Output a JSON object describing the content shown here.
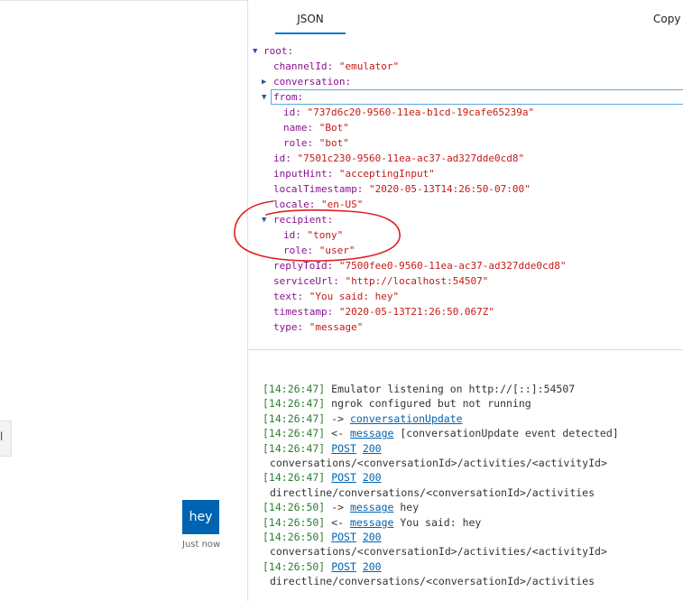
{
  "inspector": {
    "tab_json": "JSON",
    "copy_label": "Copy j"
  },
  "json": {
    "root": "root:",
    "channelId_key": "channelId:",
    "channelId_val": "\"emulator\"",
    "conversation_key": "conversation:",
    "from_key": "from:",
    "from_id_key": "id:",
    "from_id_val": "\"737d6c20-9560-11ea-b1cd-19cafe65239a\"",
    "from_name_key": "name:",
    "from_name_val": "\"Bot\"",
    "from_role_key": "role:",
    "from_role_val": "\"bot\"",
    "id_key": "id:",
    "id_val": "\"7501c230-9560-11ea-ac37-ad327dde0cd8\"",
    "inputHint_key": "inputHint:",
    "inputHint_val": "\"acceptingInput\"",
    "localTimestamp_key": "localTimestamp:",
    "localTimestamp_val": "\"2020-05-13T14:26:50-07:00\"",
    "locale_key": "locale:",
    "locale_val": "\"en-US\"",
    "recipient_key": "recipient:",
    "recipient_id_key": "id:",
    "recipient_id_val": "\"tony\"",
    "recipient_role_key": "role:",
    "recipient_role_val": "\"user\"",
    "replyToId_key": "replyToId:",
    "replyToId_val": "\"7500fee0-9560-11ea-ac37-ad327dde0cd8\"",
    "serviceUrl_key": "serviceUrl:",
    "serviceUrl_val": "\"http://localhost:54507\"",
    "text_key": "text:",
    "text_val": "\"You said: hey\"",
    "timestamp_key": "timestamp:",
    "timestamp_val": "\"2020-05-13T21:26:50.067Z\"",
    "type_key": "type:",
    "type_val": "\"message\""
  },
  "log": [
    {
      "ts": "[14:26:47]",
      "pre": " Emulator listening on http://[::]:54507",
      "link": "",
      "link2": "",
      "post": ""
    },
    {
      "ts": "[14:26:47]",
      "pre": " ngrok configured but not running",
      "link": "",
      "link2": "",
      "post": ""
    },
    {
      "ts": "[14:26:47]",
      "pre": " -> ",
      "link": "conversationUpdate",
      "link2": "",
      "post": ""
    },
    {
      "ts": "[14:26:47]",
      "pre": " <- ",
      "link": "message",
      "link2": "",
      "post": " [conversationUpdate event detected]"
    },
    {
      "ts": "[14:26:47]",
      "pre": " ",
      "link": "POST",
      "link2": "200",
      "post": ""
    },
    {
      "ts": "",
      "pre": "conversations/<conversationId>/activities/<activityId>",
      "link": "",
      "link2": "",
      "post": "",
      "indent": true
    },
    {
      "ts": "[14:26:47]",
      "pre": " ",
      "link": "POST",
      "link2": "200",
      "post": ""
    },
    {
      "ts": "",
      "pre": "directline/conversations/<conversationId>/activities",
      "link": "",
      "link2": "",
      "post": "",
      "indent": true
    },
    {
      "ts": "[14:26:50]",
      "pre": " -> ",
      "link": "message",
      "link2": "",
      "post": " hey"
    },
    {
      "ts": "[14:26:50]",
      "pre": " <- ",
      "link": "message",
      "link2": "",
      "post": " You said: hey"
    },
    {
      "ts": "[14:26:50]",
      "pre": " ",
      "link": "POST",
      "link2": "200",
      "post": ""
    },
    {
      "ts": "",
      "pre": "conversations/<conversationId>/activities/<activityId>",
      "link": "",
      "link2": "",
      "post": "",
      "indent": true
    },
    {
      "ts": "[14:26:50]",
      "pre": " ",
      "link": "POST",
      "link2": "200",
      "post": ""
    },
    {
      "ts": "",
      "pre": "directline/conversations/<conversationId>/activities",
      "link": "",
      "link2": "",
      "post": "",
      "indent": true
    }
  ],
  "chat": {
    "stub_char": "l",
    "bubble_text": "hey",
    "time_text": "Just now"
  },
  "colors": {
    "accent": "#0078d4",
    "bubble": "#0063b1",
    "annotation": "#e02020"
  }
}
